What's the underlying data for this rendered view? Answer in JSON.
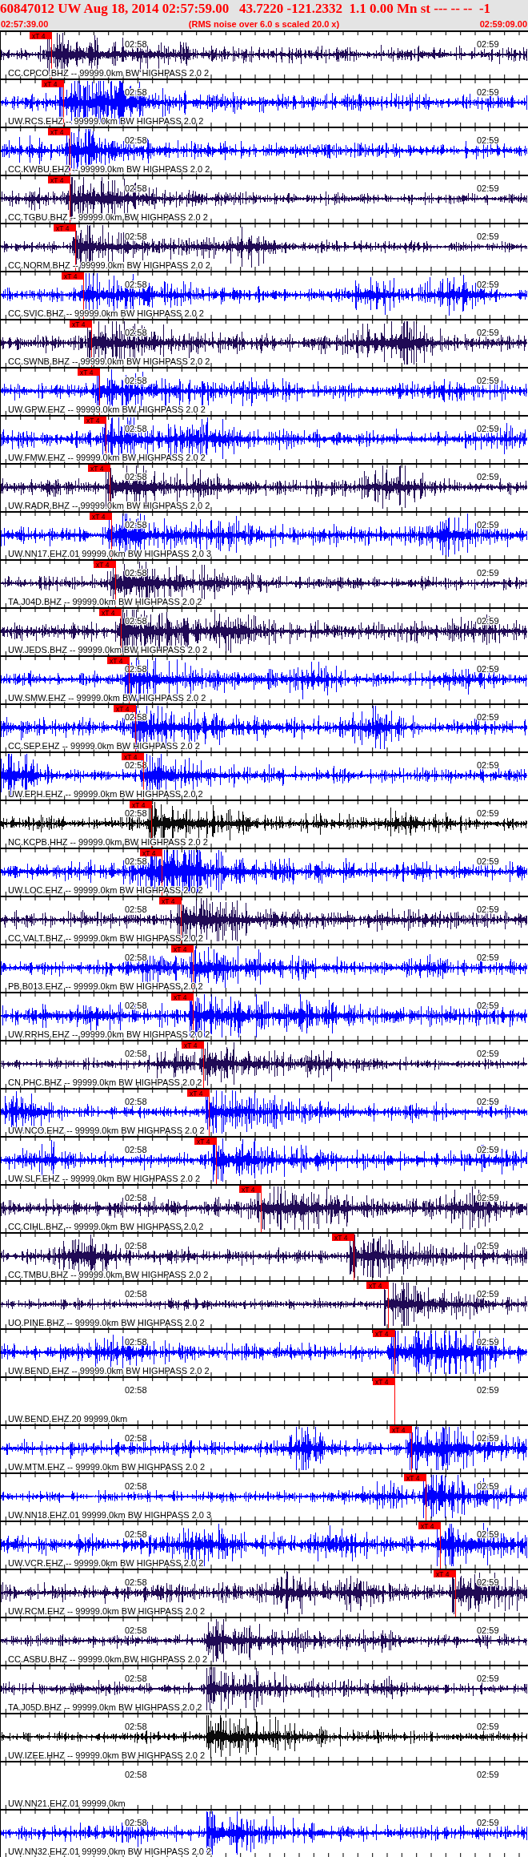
{
  "header": {
    "title": "60847012 UW Aug 18, 2014 02:57:59.00   43.7220 -121.2332  1.1 0.00 Mn st --- -- --  -1",
    "start": "02:57:39.00",
    "note": "(RMS noise over 6.0 s scaled 20.0 x)",
    "end": "02:59:09.00"
  },
  "traces": [
    {
      "label": "CC.CPCO.BHZ -- 99999.0km BW HIGHPASS 2.0 2",
      "color": "#200a55",
      "time_labels": [
        "02:58",
        "02:59"
      ],
      "pick": {
        "text": "xT 4",
        "level": 0.098
      }
    },
    {
      "label": "UW.RCS.EHZ -- 99999.0km BW HIGHPASS 2.0 2",
      "color": "#0000ff",
      "time_labels": [
        "02:58",
        "02:59"
      ],
      "pick": {
        "text": "xT 4",
        "level": 0.121
      }
    },
    {
      "label": "CC.KWBU.EHZ -- 99999.0km BW HIGHPASS 2.0 2",
      "color": "#0000ff",
      "time_labels": [
        "02:58",
        "02:59"
      ],
      "pick": {
        "text": "xT 4",
        "level": 0.133
      }
    },
    {
      "label": "CC.TGBU.BHZ -- 99999.0km BW HIGHPASS 2.0 2",
      "color": "#200a55",
      "time_labels": [
        "02:58",
        "02:59"
      ],
      "pick": {
        "text": "xT 4",
        "level": 0.133
      }
    },
    {
      "label": "CC.NORM.BHZ -- 99999.0km BW HIGHPASS 2.0 2",
      "color": "#200a55",
      "time_labels": [
        "02:58",
        "02:59"
      ],
      "pick": {
        "text": "xT 4",
        "level": 0.144
      }
    },
    {
      "label": "CC.SVIC.BHZ -- 99999.0km BW HIGHPASS 2.0 2",
      "color": "#0000ff",
      "time_labels": [
        "02:58",
        "02:59"
      ],
      "pick": {
        "text": "xT 4",
        "level": 0.159
      }
    },
    {
      "label": "CC.SWNB.BHZ -- 99999.0km BW HIGHPASS 2.0 2",
      "color": "#200a55",
      "time_labels": [
        "02:58",
        "02:59"
      ],
      "pick": {
        "text": "xT 4",
        "level": 0.174
      }
    },
    {
      "label": "UW.GPW.EHZ -- 99999.0km BW HIGHPASS 2.0 2",
      "color": "#0000ff",
      "time_labels": [
        "02:58",
        "02:59"
      ],
      "pick": {
        "text": "xT 4",
        "level": 0.189
      }
    },
    {
      "label": "UW.FMW.EHZ -- 99999.0km BW HIGHPASS 2.0 2",
      "color": "#0000ff",
      "time_labels": [
        "02:58",
        "02:59"
      ],
      "pick": {
        "text": "xT 4",
        "level": 0.202
      }
    },
    {
      "label": "UW.RADR.BHZ -- 99999.0km BW HIGHPASS 2.0 2",
      "color": "#200a55",
      "time_labels": [
        "02:58",
        "02:59"
      ],
      "pick": {
        "text": "xT 4",
        "level": 0.209
      }
    },
    {
      "label": "UW.NN17.EHZ.01 99999.0km BW HIGHPASS 2.0 3",
      "color": "#0000ff",
      "time_labels": [
        "02:58",
        "02:59"
      ],
      "pick": {
        "text": "xT 4",
        "level": 0.212
      }
    },
    {
      "label": "TA.J04D.BHZ -- 99999.0km BW HIGHPASS 2.0 2",
      "color": "#200a55",
      "time_labels": [
        "02:58",
        "02:59"
      ],
      "pick": {
        "text": "xT 4",
        "level": 0.22
      }
    },
    {
      "label": "UW.JEDS.BHZ -- 99999.0km BW HIGHPASS 2.0 2",
      "color": "#200a55",
      "time_labels": [
        "02:58",
        "02:59"
      ],
      "pick": {
        "text": "xT 4",
        "level": 0.23
      }
    },
    {
      "label": "UW.SMW.EHZ -- 99999.0km BW HIGHPASS 2.0 2",
      "color": "#0000ff",
      "time_labels": [
        "02:58",
        "02:59"
      ],
      "pick": {
        "text": "xT 4",
        "level": 0.245
      }
    },
    {
      "label": "CC.SEP.EHZ -- 99999.0km BW HIGHPASS 2.0 2",
      "color": "#0000ff",
      "time_labels": [
        "02:58",
        "02:59"
      ],
      "pick": {
        "text": "xT 4",
        "level": 0.258
      }
    },
    {
      "label": "UW.EPH.EHZ -- 99999.0km BW HIGHPASS 2.0 2",
      "color": "#0000ff",
      "time_labels": [
        "02:58",
        "02:59"
      ],
      "pick": {
        "text": "xT 4",
        "level": 0.273
      }
    },
    {
      "label": "NC.KCPB.HHZ -- 99999.0km BW HIGHPASS 2.0 2",
      "color": "#0a0a0a",
      "time_labels": [
        "02:58",
        "02:59"
      ],
      "pick": {
        "text": "xT 4",
        "level": 0.288
      }
    },
    {
      "label": "UW.LOC.EHZ -- 99999.0km BW HIGHPASS 2.0 2",
      "color": "#0000ff",
      "time_labels": [
        "02:58",
        "02:59"
      ],
      "pick": {
        "text": "xT 4",
        "level": 0.308
      }
    },
    {
      "label": "CC.VALT.BHZ -- 99999.0km BW HIGHPASS 2.0 2",
      "color": "#200a55",
      "time_labels": [
        "02:58",
        "02:59"
      ],
      "pick": {
        "text": "xT 4",
        "level": 0.344
      }
    },
    {
      "label": "PB.B013.EHZ -- 99999.0km BW HIGHPASS 2.0 2",
      "color": "#0000ff",
      "time_labels": [
        "02:58",
        "02:59"
      ],
      "pick": {
        "text": "xT 4",
        "level": 0.367
      }
    },
    {
      "label": "UW.RRHS.EHZ -- 99999.0km BW HIGHPASS 2.0 2",
      "color": "#0000ff",
      "time_labels": [
        "02:58",
        "02:59"
      ],
      "pick": {
        "text": "xT 4",
        "level": 0.367
      }
    },
    {
      "label": "CN.PHC.BHZ -- 99999.0km BW HIGHPASS 2.0 2",
      "color": "#200a55",
      "time_labels": [
        "02:58",
        "02:59"
      ],
      "pick": {
        "text": "xT 4",
        "level": 0.386
      }
    },
    {
      "label": "UW.NCO.EHZ -- 99999.0km BW HIGHPASS 2.0 2",
      "color": "#0000ff",
      "time_labels": [
        "02:58",
        "02:59"
      ],
      "pick": {
        "text": "xT 4",
        "level": 0.397
      }
    },
    {
      "label": "UW.SLF.EHZ -- 99999.0km BW HIGHPASS 2.0 2",
      "color": "#0000ff",
      "time_labels": [
        "02:58",
        "02:59"
      ],
      "pick": {
        "text": "xT 4",
        "level": 0.411
      }
    },
    {
      "label": "CC.CIHL.BHZ -- 99999.0km BW HIGHPASS 2.0 2",
      "color": "#200a55",
      "time_labels": [
        "02:58",
        "02:59"
      ],
      "pick": {
        "text": "xT 4",
        "level": 0.495
      }
    },
    {
      "label": "CC.TMBU.BHZ -- 99999.0km BW HIGHPASS 2.0 2",
      "color": "#200a55",
      "time_labels": [
        "02:58",
        "02:59"
      ],
      "pick": {
        "text": "xT 4",
        "level": 0.671
      }
    },
    {
      "label": "UO.PINE.BHZ -- 99999.0km BW HIGHPASS 2.0 2",
      "color": "#200a55",
      "time_labels": [
        "02:58",
        "02:59"
      ],
      "pick": {
        "text": "xT 4",
        "level": 0.736
      }
    },
    {
      "label": "UW.BEND.EHZ -- 99999.0km BW HIGHPASS 2.0 2",
      "color": "#0000ff",
      "time_labels": [
        "02:58",
        "02:59"
      ],
      "pick": {
        "text": "xT 4",
        "level": 0.748
      }
    },
    {
      "label": "UW.BEND.EHZ.20 99999.0km",
      "time_labels": [
        "02:58",
        "02:59"
      ],
      "pick": {
        "text": "xT 4",
        "level": 0.748
      }
    },
    {
      "label": "UW.MTM.EHZ -- 99999.0km BW HIGHPASS 2.0 2",
      "color": "#0000ff",
      "time_labels": [
        "02:58",
        "02:59"
      ],
      "pick": {
        "text": "xT 4",
        "level": 0.78
      }
    },
    {
      "label": "UW.NN18.EHZ.01 99999.0km BW HIGHPASS 2.0 3",
      "color": "#0000ff",
      "time_labels": [
        "02:58",
        "02:59"
      ],
      "pick": {
        "text": "xT 4",
        "level": 0.808
      }
    },
    {
      "label": "UW.VCR.EHZ -- 99999.0km BW HIGHPASS 2.0 2",
      "color": "#0000ff",
      "time_labels": [
        "02:58",
        "02:59"
      ],
      "pick": {
        "text": "xT 4",
        "level": 0.835
      }
    },
    {
      "label": "UW.RCM.EHZ -- 99999.0km BW HIGHPASS 2.0 2",
      "color": "#200a55",
      "time_labels": [
        "02:58",
        "02:59"
      ],
      "pick": {
        "text": "xT 4",
        "level": 0.864
      }
    },
    {
      "label": "CC.ASBU.BHZ -- 99999.0km BW HIGHPASS 2.0 2",
      "color": "#200a55",
      "time_labels": [
        "02:58",
        "02:59"
      ]
    },
    {
      "label": "TA.J05D.BHZ -- 99999.0km BW HIGHPASS 2.0 2",
      "color": "#200a55",
      "time_labels": [
        "02:58",
        "02:59"
      ]
    },
    {
      "label": "UW.IZEE.HHZ -- 99999.0km BW HIGHPASS 2.0 2",
      "color": "#0a0a0a",
      "time_labels": [
        "02:58",
        "02:59"
      ]
    },
    {
      "label": "UW.NN21.EHZ.01 99999.0km",
      "time_labels": [
        "02:58",
        "02:59"
      ]
    },
    {
      "label": "UW.NN32.EHZ.01 99999.0km BW HIGHPASS 2.0 2",
      "color": "#0000ff",
      "time_labels": [
        "02:58",
        "02:59"
      ]
    }
  ]
}
